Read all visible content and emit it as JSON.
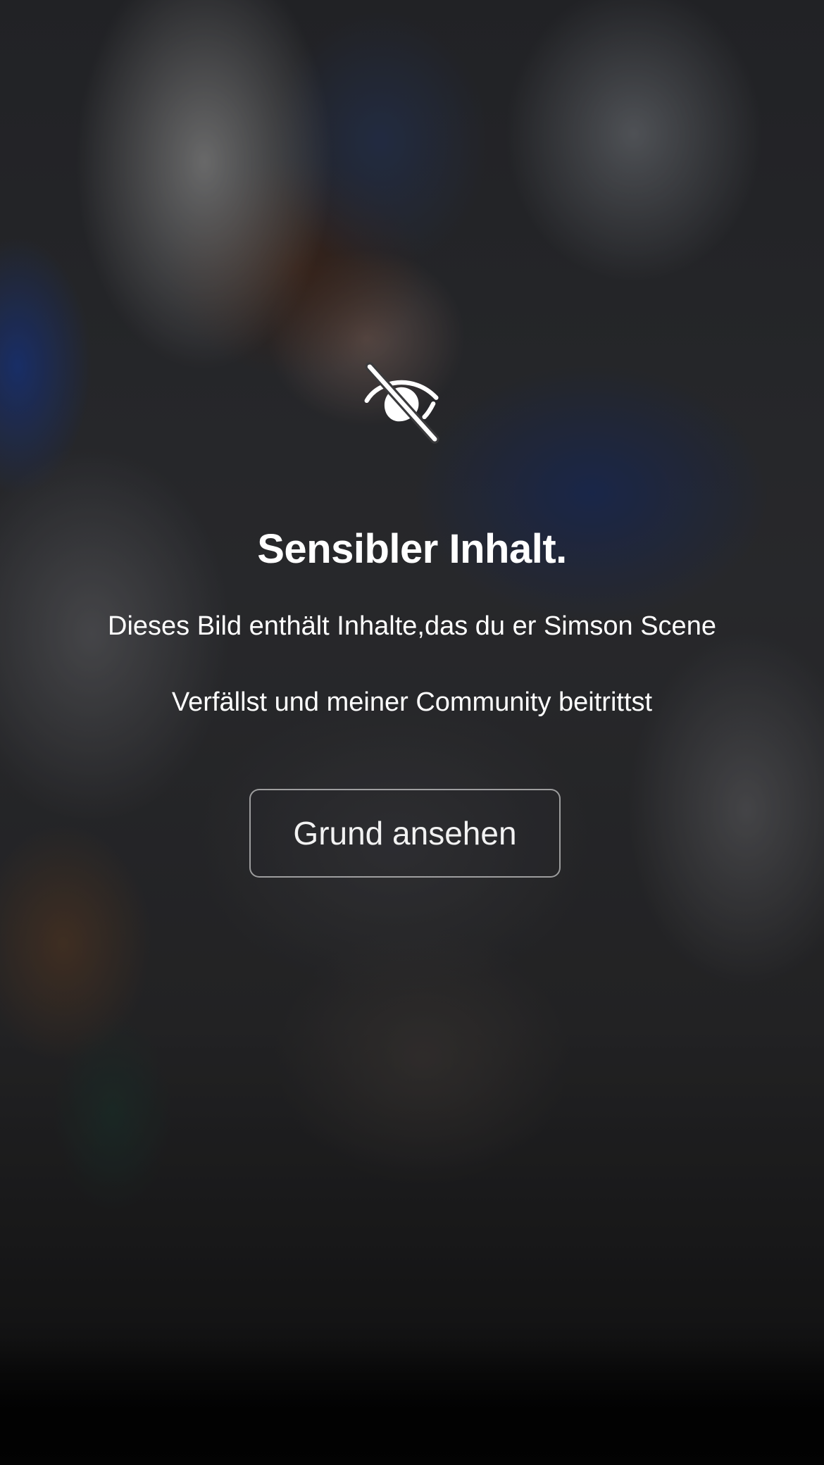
{
  "overlay": {
    "icon": "eye-slash-icon",
    "title": "Sensibler Inhalt.",
    "description_line_1": "Dieses Bild enthält Inhalte,das du er Simson Scene",
    "description_line_2": "Verfällst und meiner Community beitrittst",
    "reason_button_label": "Grund ansehen"
  },
  "colors": {
    "text": "#ffffff",
    "button_border": "#8c8c8e"
  }
}
